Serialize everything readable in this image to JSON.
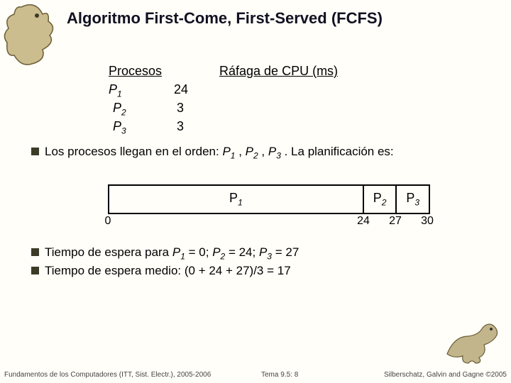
{
  "title": "Algoritmo First-Come, First-Served (FCFS)",
  "table": {
    "hdr_proc": "Procesos",
    "hdr_burst": "Ráfaga de CPU (ms)",
    "rows": [
      {
        "name": "P",
        "sub": "1",
        "val": "24"
      },
      {
        "name": "P",
        "sub": "2",
        "val": "3"
      },
      {
        "name": "P",
        "sub": "3",
        "val": "3"
      }
    ]
  },
  "line1_a": "Los procesos llegan en el orden: ",
  "line1_p1": "P",
  "line1_p1s": "1",
  "line1_c1": " , ",
  "line1_p2": "P",
  "line1_p2s": "2",
  "line1_c2": " , ",
  "line1_p3": "P",
  "line1_p3s": "3",
  "line1_b": " . La planificación es:",
  "gantt": {
    "seg1": {
      "label": "P",
      "sub": "1",
      "flex": 24
    },
    "seg2": {
      "label": "P",
      "sub": "2",
      "flex": 3
    },
    "seg3": {
      "label": "P",
      "sub": "3",
      "flex": 3
    }
  },
  "ticks": {
    "t0": "0",
    "t1": "24",
    "t2": "27",
    "t3": "30"
  },
  "line2_a": "Tiempo de espera para ",
  "line2_p1": "P",
  "line2_p1s": "1",
  "line2_e1": " = 0; ",
  "line2_p2": "P",
  "line2_p2s": "2",
  "line2_e2": " = 24; ",
  "line2_p3": "P",
  "line2_p3s": "3",
  "line2_e3": " = 27",
  "line3": "Tiempo de espera medio:  (0 + 24 + 27)/3 = 17",
  "footer_left": "Fundamentos de los Computadores (ITT, Sist. Electr.), 2005-2006",
  "footer_center": "Tema 9.5: 8",
  "footer_right": "Silberschatz, Galvin and Gagne ©2005",
  "chart_data": {
    "type": "table",
    "title": "FCFS Scheduling Example",
    "columns": [
      "Proceso",
      "Ráfaga de CPU (ms)"
    ],
    "rows": [
      [
        "P1",
        24
      ],
      [
        "P2",
        3
      ],
      [
        "P3",
        3
      ]
    ],
    "gantt": [
      {
        "process": "P1",
        "start": 0,
        "end": 24
      },
      {
        "process": "P2",
        "start": 24,
        "end": 27
      },
      {
        "process": "P3",
        "start": 27,
        "end": 30
      }
    ],
    "waiting_times": {
      "P1": 0,
      "P2": 24,
      "P3": 27
    },
    "average_waiting_time": 17
  }
}
